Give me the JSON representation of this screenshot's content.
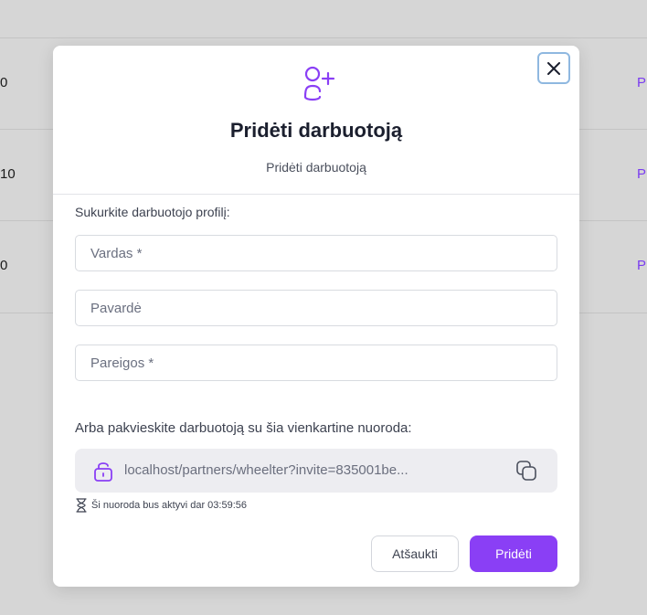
{
  "background": {
    "rows": [
      {
        "left": "0",
        "right": "P"
      },
      {
        "left": "10",
        "right": "P"
      },
      {
        "left": "0",
        "right": "P"
      }
    ]
  },
  "modal": {
    "title": "Pridėti darbuotoją",
    "subtitle": "Pridėti darbuotoją",
    "icon": "user-plus-icon",
    "close_icon": "close-icon",
    "section_label": "Sukurkite darbuotojo profilį:",
    "fields": {
      "first_name": {
        "placeholder": "Vardas *",
        "value": ""
      },
      "last_name": {
        "placeholder": "Pavardė",
        "value": ""
      },
      "position": {
        "placeholder": "Pareigos *",
        "value": ""
      }
    },
    "invite_label": "Arba pakvieskite darbuotoją su šia vienkartine nuoroda:",
    "invite_link": "localhost/partners/wheelter?invite=835001be...",
    "expiry_text": "Ši nuoroda bus aktyvi dar 03:59:56",
    "cancel_label": "Atšaukti",
    "submit_label": "Pridėti"
  },
  "colors": {
    "accent": "#8a3ff5",
    "backdrop": "#d6d6d6",
    "link_box": "#ededf1"
  }
}
